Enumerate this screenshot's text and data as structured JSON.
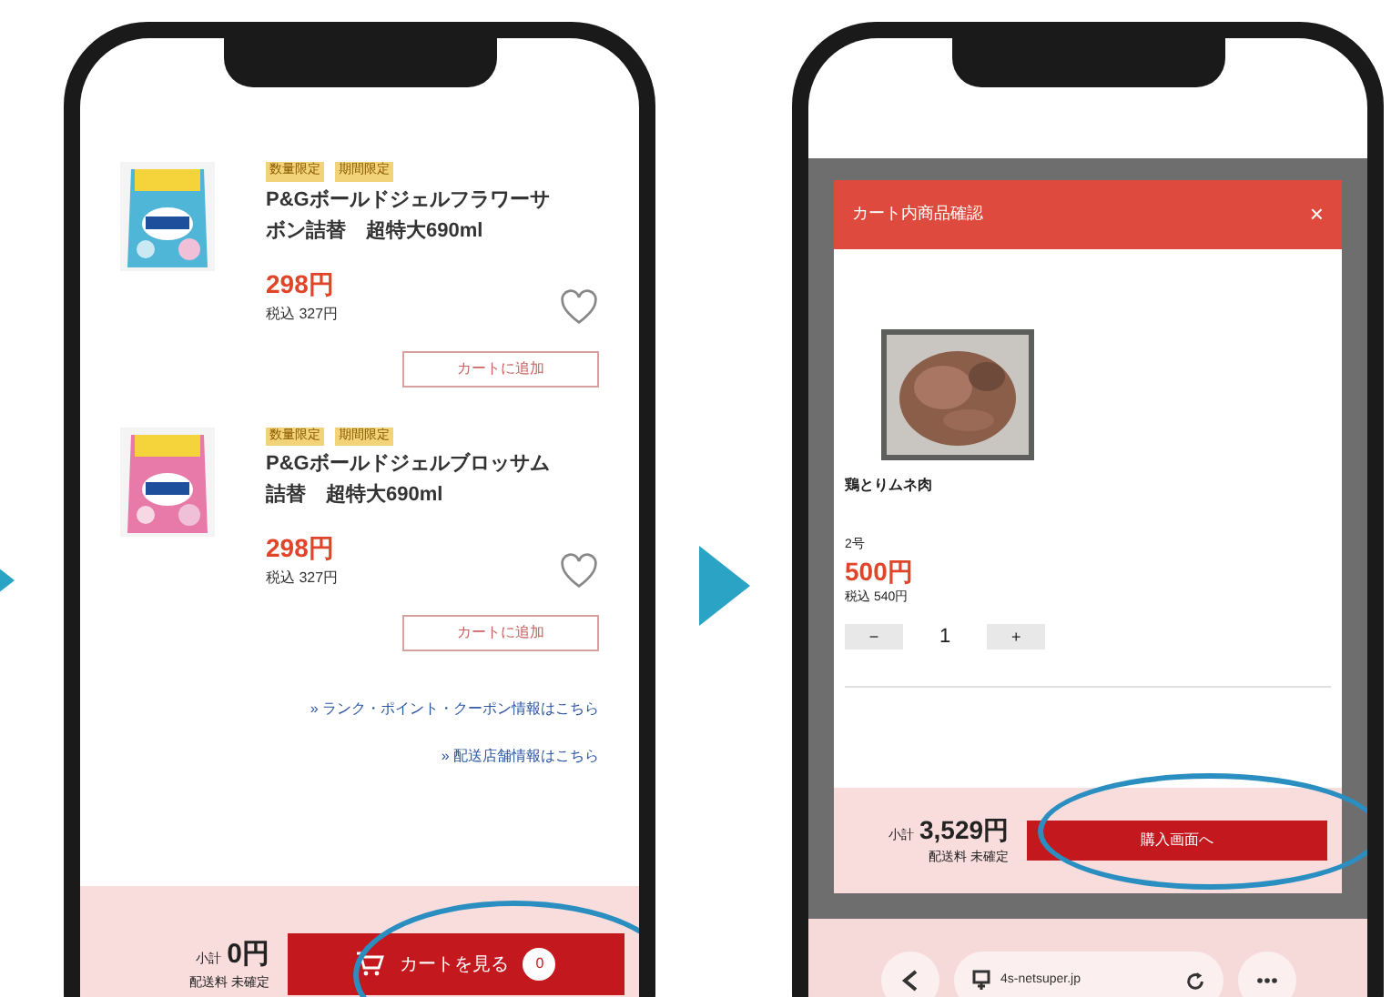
{
  "screens": [
    {
      "kind": "product_list",
      "products": [
        {
          "tags": [
            "数量限定",
            "期間限定"
          ],
          "name": "P&Gボールドジェルフラワーサボン詰替　超特大690ml",
          "price": "298円",
          "tax_price": "税込 327円",
          "favorite": false,
          "add_button": "カートに追加",
          "color": "#4fb6d8"
        },
        {
          "tags": [
            "数量限定",
            "期間限定"
          ],
          "name": "P&Gボールドジェルブロッサム詰替　超特大690ml",
          "price": "298円",
          "tax_price": "税込 327円",
          "favorite": false,
          "add_button": "カートに追加",
          "color": "#e77aa8"
        }
      ],
      "links": [
        "» ランク・ポイント・クーポン情報はこちら",
        "» 配送店舗情報はこちら"
      ],
      "footer": {
        "subtotal_label": "小計",
        "subtotal": "0円",
        "shipping": "配送料 未確定",
        "button": "カートを見る",
        "count": "0",
        "highlighted": true
      }
    },
    {
      "kind": "cart_modal",
      "title": "カート内商品確認",
      "close": "×",
      "item": {
        "name": "鶏とりムネ肉",
        "size": "2号",
        "price": "500円",
        "tax_price": "税込 540円",
        "minus": "−",
        "quantity": "1",
        "plus": "+"
      },
      "footer": {
        "subtotal_label": "小計",
        "subtotal": "3,529円",
        "shipping": "配送料 未確定",
        "button": "購入画面へ",
        "highlighted": true
      },
      "browser": {
        "url": "4s-netsuper.jp"
      }
    }
  ]
}
